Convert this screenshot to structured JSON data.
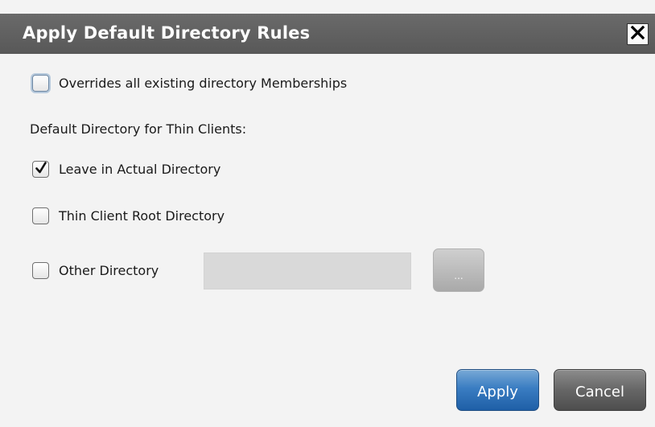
{
  "dialog": {
    "title": "Apply Default Directory Rules",
    "close_icon": "close-icon"
  },
  "override": {
    "label": "Overrides all existing directory Memberships",
    "checked": false
  },
  "section_label": "Default Directory for Thin Clients:",
  "options": [
    {
      "label": "Leave in Actual Directory",
      "checked": true
    },
    {
      "label": "Thin Client Root Directory",
      "checked": false
    },
    {
      "label": "Other Directory",
      "checked": false
    }
  ],
  "other_directory": {
    "value": "",
    "browse_label": "..."
  },
  "buttons": {
    "apply": "Apply",
    "cancel": "Cancel"
  },
  "colors": {
    "titlebar": "#5f5f5f",
    "apply": "#2f6fb6",
    "cancel": "#5a5a5a"
  }
}
